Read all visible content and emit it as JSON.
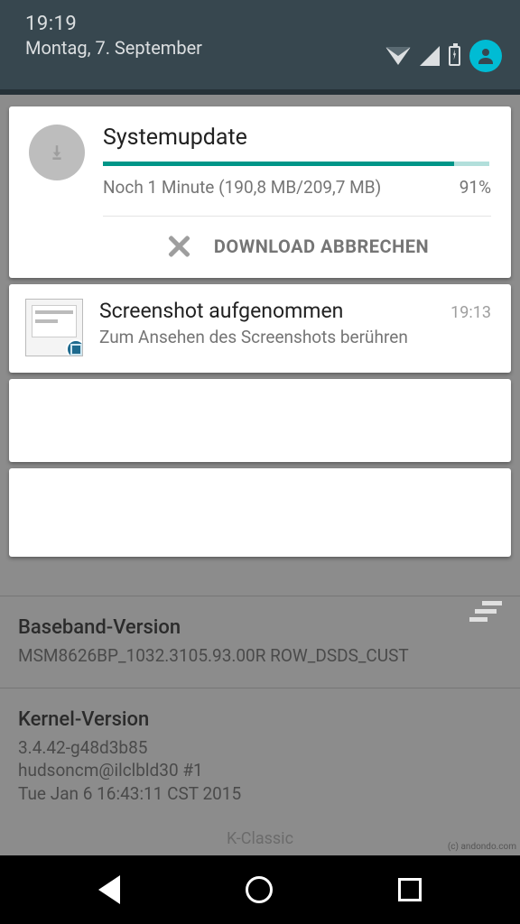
{
  "status": {
    "time": "19:19",
    "date": "Montag, 7. September"
  },
  "notifications": {
    "systemupdate": {
      "title": "Systemupdate",
      "subtitle": "Noch 1 Minute (190,8  MB/209,7  MB)",
      "percent_text": "91%",
      "progress_pct": 91,
      "action": "DOWNLOAD ABBRECHEN"
    },
    "screenshot": {
      "title": "Screenshot aufgenommen",
      "time": "19:13",
      "subtitle": "Zum Ansehen des Screenshots berühren"
    }
  },
  "background": {
    "baseband": {
      "label": "Baseband-Version",
      "value": "MSM8626BP_1032.3105.93.00R ROW_DSDS_CUST"
    },
    "kernel": {
      "label": "Kernel-Version",
      "value": "3.4.42-g48d3b85\nhudsoncm@ilclbld30 #1\nTue Jan 6 16:43:11 CST 2015"
    },
    "brand": "K-Classic"
  },
  "watermark": "(c) andondo.com"
}
